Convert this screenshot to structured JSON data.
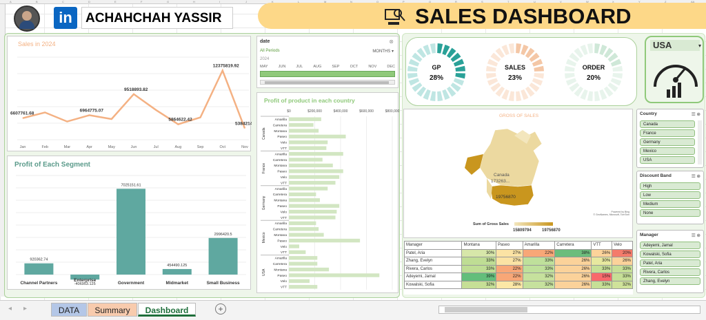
{
  "header": {
    "name": "ACHAHCHAH YASSIR",
    "linkedin": "in",
    "dashboard_title": "SALES DASHBOARD"
  },
  "columns": [
    "A",
    "B",
    "C",
    "D",
    "E",
    "F",
    "G",
    "H",
    "I",
    "J",
    "K",
    "L",
    "M",
    "N",
    "O",
    "P",
    "Q",
    "R",
    "S",
    "T",
    "U",
    "V",
    "W",
    "X",
    "Y",
    "Z",
    "AA"
  ],
  "sales_chart": {
    "title": "Sales in 2024",
    "chart_data": {
      "type": "line",
      "categories": [
        "Jan",
        "Feb",
        "Mar",
        "Apr",
        "May",
        "Jun",
        "Jul",
        "Aug",
        "Sep",
        "Oct",
        "Nov"
      ],
      "values": [
        6607761.68,
        7300000,
        6200000,
        6964775.07,
        6500000,
        9518893.82,
        7600000,
        5864622.42,
        6700000,
        12375819.92,
        5384214.2
      ],
      "labels": [
        "6607761.68",
        "",
        "",
        "6964775.07",
        "",
        "9518893.82",
        "",
        "5864622.42",
        "",
        "12375819.92",
        "5384214.2"
      ],
      "ylim": [
        4000000,
        14000000
      ]
    }
  },
  "segment_chart": {
    "title": "Profit of Each Segment",
    "chart_data": {
      "type": "bar",
      "categories": [
        "Channel Partners",
        "Enterprise",
        "Government",
        "Midmarket",
        "Small Business"
      ],
      "values": [
        920362.74,
        -406953.125,
        7025151.61,
        454490.125,
        2996420.5
      ],
      "labels": [
        "920362.74",
        "-406953.125",
        "7025151.61",
        "454490.125",
        "2996420.5"
      ],
      "ylim": [
        -800000,
        8000000
      ]
    }
  },
  "timeline": {
    "field": "date",
    "periods_label": "All Periods",
    "unit": "MONTHS",
    "year": "2024",
    "months": [
      "MAY",
      "JUN",
      "JUL",
      "AUG",
      "SEP",
      "OCT",
      "NOV",
      "DEC"
    ]
  },
  "country_chart": {
    "title": "Profit of product in each country",
    "chart_data": {
      "type": "bar",
      "axis_ticks": [
        "$0",
        "$200,000",
        "$400,000",
        "$600,000",
        "$800,000"
      ],
      "xlim": [
        0,
        800000
      ],
      "groups": [
        {
          "country": "Canada",
          "products": [
            "Amarilla",
            "Carretera",
            "Montana",
            "Paseo",
            "Velo",
            "VTT"
          ],
          "values": [
            250000,
            190000,
            230000,
            440000,
            300000,
            290000
          ]
        },
        {
          "country": "France",
          "products": [
            "Amarilla",
            "Carretera",
            "Montana",
            "Paseo",
            "Velo",
            "VTT"
          ],
          "values": [
            420000,
            260000,
            340000,
            420000,
            390000,
            360000
          ]
        },
        {
          "country": "Germany",
          "products": [
            "Amarilla",
            "Carretera",
            "Montana",
            "Paseo",
            "Velo",
            "VTT"
          ],
          "values": [
            300000,
            210000,
            240000,
            390000,
            370000,
            360000
          ]
        },
        {
          "country": "Mexico",
          "products": [
            "Amarilla",
            "Carretera",
            "Montana",
            "Paseo",
            "Velo",
            "VTT"
          ],
          "values": [
            210000,
            230000,
            270000,
            550000,
            80000,
            130000
          ]
        },
        {
          "country": "USA",
          "products": [
            "Amarilla",
            "Carretera",
            "Montana",
            "Paseo",
            "Velo",
            "VTT"
          ],
          "values": [
            220000,
            220000,
            310000,
            700000,
            160000,
            220000
          ]
        }
      ]
    }
  },
  "kpis": [
    {
      "label": "GP",
      "value": "28%",
      "pct": 0.28,
      "color": "#2aa198",
      "light": "#bfe6e3"
    },
    {
      "label": "SALES",
      "value": "23%",
      "pct": 0.23,
      "color": "#f4c7a6",
      "light": "#fbe7d8"
    },
    {
      "label": "ORDER",
      "value": "20%",
      "pct": 0.2,
      "color": "#cfe8d8",
      "light": "#e8f4ec"
    }
  ],
  "country_selector": {
    "value": "USA"
  },
  "map": {
    "title": "GROSS OF SALES",
    "canada_label": "Canada",
    "canada_value": "173263...",
    "usa_value": "19756870",
    "legend_title": "Sum of Gross Sales",
    "legend_min": "15809794",
    "legend_max": "19756870",
    "credit1": "Powered by Bing",
    "credit2": "© GeoNames, Microsoft, TomTom"
  },
  "heatmap": {
    "headers": [
      "Manager",
      "Montana",
      "Paseo",
      "Amarilla",
      "Carretera",
      "VTT",
      "Velo"
    ],
    "rows": [
      {
        "name": "Patel, Aria",
        "vals": [
          "30%",
          "27%",
          "22%",
          "38%",
          "26%",
          "20%"
        ],
        "colors": [
          "#d7e7a9",
          "#fbe3a4",
          "#f8a777",
          "#6cbd7c",
          "#fdd39a",
          "#f47b6b"
        ]
      },
      {
        "name": "Zhang, Evelyn",
        "vals": [
          "33%",
          "27%",
          "33%",
          "26%",
          "30%",
          "26%"
        ],
        "colors": [
          "#bfdd94",
          "#fbe3a4",
          "#bfe09b",
          "#fbd29a",
          "#e7e89f",
          "#fbd29a"
        ]
      },
      {
        "name": "Rivera, Carlos",
        "vals": [
          "33%",
          "22%",
          "33%",
          "26%",
          "33%",
          "33%"
        ],
        "colors": [
          "#bfdd94",
          "#f8a777",
          "#bfe09b",
          "#fbd29a",
          "#c6df96",
          "#c6df96"
        ]
      },
      {
        "name": "Adeyemi, Jamal",
        "vals": [
          "39%",
          "22%",
          "32%",
          "26%",
          "15%",
          "33%"
        ],
        "colors": [
          "#63be7b",
          "#f8a777",
          "#c6e19d",
          "#fbd29a",
          "#f8696b",
          "#c6df96"
        ]
      },
      {
        "name": "Kowalski, Sofia",
        "vals": [
          "32%",
          "28%",
          "32%",
          "26%",
          "33%",
          "32%"
        ],
        "colors": [
          "#c6df96",
          "#fbe7a6",
          "#c6e19d",
          "#fbd29a",
          "#c6df96",
          "#cfe29a"
        ]
      }
    ]
  },
  "country_slicer": {
    "title": "Country",
    "items": [
      "Canada",
      "France",
      "Germany",
      "Mexico",
      "USA"
    ]
  },
  "discount_slicer": {
    "title": "Discount Band",
    "items": [
      "High",
      "Low",
      "Medium",
      "None"
    ]
  },
  "manager_slicer": {
    "title": "Manager",
    "items": [
      "Adeyemi, Jamal",
      "Kowalski, Sofia",
      "Patel, Aria",
      "Rivera, Carlos",
      "Zhang, Evelyn"
    ]
  },
  "tabs": [
    {
      "label": "DATA"
    },
    {
      "label": "Summary"
    },
    {
      "label": "Dashboard"
    }
  ],
  "icons": {
    "add_sheet": "plus-circle-icon",
    "filter": "filter-icon",
    "multi_select": "multi-select-icon"
  }
}
